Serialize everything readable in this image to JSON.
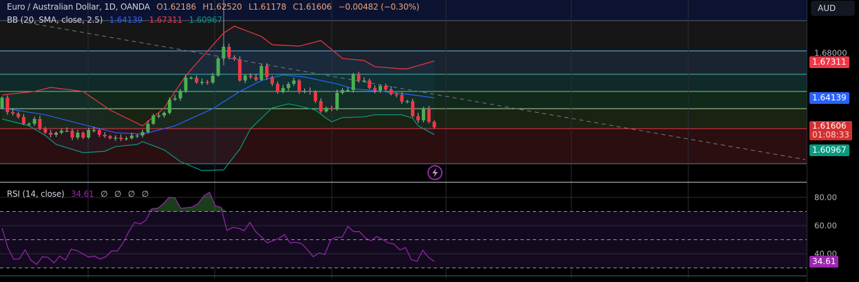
{
  "header": {
    "title": "Euro / Australian Dollar, 1D, OANDA",
    "open": "O1.62186",
    "high": "H1.62520",
    "low": "L1.61178",
    "close": "C1.61606",
    "change": "−0.00482 (−0.30%)"
  },
  "bb": {
    "label": "BB (20, SMA, close, 2.5)",
    "basis": "1.64139",
    "upper": "1.67311",
    "lower": "1.60967"
  },
  "rsi": {
    "label": "RSI (14, close)",
    "value": "34.61",
    "extras": [
      "∅",
      "∅",
      "∅",
      "∅"
    ]
  },
  "currency_button": "AUD",
  "price_axis": {
    "tick_1": "1.68000",
    "upper_tag": "1.67311",
    "basis_tag": "1.64139",
    "last_price": "1.61606",
    "countdown": "01:08:33",
    "lower_tag": "1.60967"
  },
  "rsi_axis": {
    "ticks": [
      "80.00",
      "60.00",
      "40.00"
    ],
    "value_tag": "34.61"
  },
  "colors": {
    "bull": "#4caf50",
    "bear": "#f23645",
    "bb_upper": "#f23645",
    "bb_basis": "#2962ff",
    "bb_lower": "#089981",
    "rsi": "#9c27b0"
  },
  "series": {
    "first_open": 1.6327,
    "closes": [
      1.6415,
      1.6291,
      1.6279,
      1.625,
      1.6191,
      1.6191,
      1.6232,
      1.6149,
      1.6114,
      1.6096,
      1.6114,
      1.6131,
      1.6131,
      1.6072,
      1.6114,
      1.6072,
      1.6137,
      1.6137,
      1.6096,
      1.6084,
      1.6066,
      1.6072,
      1.606,
      1.6066,
      1.609,
      1.609,
      1.612,
      1.6191,
      1.6262,
      1.6262,
      1.6285,
      1.6398,
      1.641,
      1.6475,
      1.6587,
      1.6587,
      1.6546,
      1.6551,
      1.6546,
      1.6605,
      1.6753,
      1.6853,
      1.6764,
      1.6747,
      1.6563,
      1.6605,
      1.6593,
      1.6569,
      1.6688,
      1.6593,
      1.6534,
      1.6463,
      1.6498,
      1.6534,
      1.6563,
      1.6463,
      1.6475,
      1.6463,
      1.6386,
      1.6297,
      1.6327,
      1.6321,
      1.6457,
      1.6481,
      1.6481,
      1.6617,
      1.6563,
      1.6563,
      1.6498,
      1.6475,
      1.6516,
      1.6486,
      1.6445,
      1.6439,
      1.638,
      1.6386,
      1.6256,
      1.622,
      1.6321,
      1.6208,
      1.61606
    ],
    "bb_upper": [
      [
        0,
        1.6439
      ],
      [
        6,
        1.6469
      ],
      [
        9,
        1.6504
      ],
      [
        15,
        1.6469
      ],
      [
        20,
        1.6309
      ],
      [
        26,
        1.6173
      ],
      [
        30,
        1.6327
      ],
      [
        34,
        1.6605
      ],
      [
        37,
        1.6764
      ],
      [
        41,
        1.6972
      ],
      [
        43,
        1.7031
      ],
      [
        48,
        1.6942
      ],
      [
        50,
        1.6871
      ],
      [
        55,
        1.6859
      ],
      [
        59,
        1.6907
      ],
      [
        63,
        1.6753
      ],
      [
        67,
        1.6735
      ],
      [
        69,
        1.6682
      ],
      [
        74,
        1.6664
      ],
      [
        75,
        1.6664
      ],
      [
        80,
        1.6731
      ]
    ],
    "bb_basis": [
      [
        0,
        1.6327
      ],
      [
        8,
        1.6268
      ],
      [
        16,
        1.6173
      ],
      [
        21,
        1.6114
      ],
      [
        26,
        1.6102
      ],
      [
        32,
        1.6173
      ],
      [
        39,
        1.6321
      ],
      [
        44,
        1.6469
      ],
      [
        48,
        1.6563
      ],
      [
        52,
        1.6611
      ],
      [
        56,
        1.6593
      ],
      [
        62,
        1.6534
      ],
      [
        65,
        1.6492
      ],
      [
        69,
        1.6475
      ],
      [
        76,
        1.6439
      ],
      [
        80,
        1.6414
      ]
    ],
    "bb_lower": [
      [
        0,
        1.6232
      ],
      [
        5,
        1.6173
      ],
      [
        8,
        1.609
      ],
      [
        10,
        1.6013
      ],
      [
        15,
        1.5942
      ],
      [
        19,
        1.5954
      ],
      [
        21,
        1.5995
      ],
      [
        25,
        1.6013
      ],
      [
        26,
        1.6037
      ],
      [
        30,
        1.5966
      ],
      [
        33,
        1.5865
      ],
      [
        37,
        1.5788
      ],
      [
        41,
        1.5794
      ],
      [
        44,
        1.5972
      ],
      [
        46,
        1.6149
      ],
      [
        50,
        1.6327
      ],
      [
        53,
        1.6362
      ],
      [
        55,
        1.6344
      ],
      [
        58,
        1.6309
      ],
      [
        60,
        1.6238
      ],
      [
        61,
        1.6208
      ],
      [
        63,
        1.6244
      ],
      [
        67,
        1.625
      ],
      [
        69,
        1.6268
      ],
      [
        74,
        1.6268
      ],
      [
        76,
        1.6238
      ],
      [
        77,
        1.6173
      ],
      [
        80,
        1.6097
      ]
    ],
    "rsi_values": [
      58.2,
      44.4,
      36.3,
      36.3,
      42.8,
      35.5,
      32.5,
      37.9,
      37.4,
      33.5,
      38.4,
      35.5,
      43.3,
      42.3,
      40,
      37.7,
      38.4,
      36.3,
      37.9,
      42,
      42,
      47.7,
      55.8,
      62.3,
      61.2,
      63.9,
      72,
      72.3,
      75.6,
      80.2,
      79.7,
      72.3,
      72.7,
      73.2,
      75.6,
      81,
      83.7,
      74.1,
      72.9,
      56.6,
      58.7,
      58.2,
      56.3,
      62.3,
      55.8,
      52,
      47.7,
      49.3,
      50.9,
      53.6,
      47.7,
      48.2,
      47.2,
      42.8,
      37.9,
      40.6,
      39.5,
      49.7,
      51.7,
      51.7,
      59.4,
      55.8,
      55.8,
      51.4,
      49.3,
      52.2,
      50.2,
      47.7,
      46.9,
      42.8,
      44.4,
      35.9,
      34.7,
      42.5,
      37.4,
      34.61
    ]
  }
}
